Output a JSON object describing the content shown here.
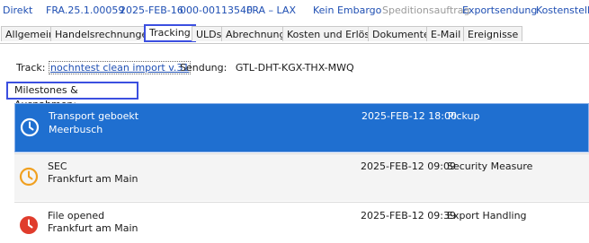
{
  "header": {
    "direkt": "Direkt",
    "ref": "FRA.25.1.00059",
    "date": "2025-FEB-16",
    "awb": "000-00113540",
    "route": "FRA – LAX",
    "embargo": "Kein Embargo",
    "speditionsauftrag": "Speditionsauftrag",
    "exportsendung": "Exportsendung",
    "kostenstelle": "Kostenstelle"
  },
  "tabs": [
    {
      "label": "Allgemein"
    },
    {
      "label": "Handelsrechnungen"
    },
    {
      "label": "Tracking"
    },
    {
      "label": "ULDs"
    },
    {
      "label": "Abrechnung"
    },
    {
      "label": "Kosten und Erlöse"
    },
    {
      "label": "Dokumente"
    },
    {
      "label": "E-Mail"
    },
    {
      "label": "Ereignisse"
    }
  ],
  "tracking": {
    "track_label": "Track:",
    "track_value": "nochntest clean import v.31",
    "sendung_label": "Sendung:",
    "sendung_value": "GTL-DHT-KGX-THX-MWQ",
    "section_title": "Milestones & Ausnahmen:"
  },
  "milestones": [
    {
      "title": "Transport geboekt",
      "place": "Meerbusch",
      "timestamp": "2025-FEB-12 18:00",
      "event": "Pickup",
      "icon": "clock-icon",
      "color": "#ffffff"
    },
    {
      "title": "SEC",
      "place": "Frankfurt am Main",
      "timestamp": "2025-FEB-12 09:09",
      "event": "Security Measure",
      "icon": "clock-icon",
      "color": "#f0a020"
    },
    {
      "title": "File opened",
      "place": "Frankfurt am Main",
      "timestamp": "2025-FEB-12 09:39",
      "event": "Export Handling",
      "icon": "clock-icon",
      "color": "#e03c2c"
    }
  ]
}
